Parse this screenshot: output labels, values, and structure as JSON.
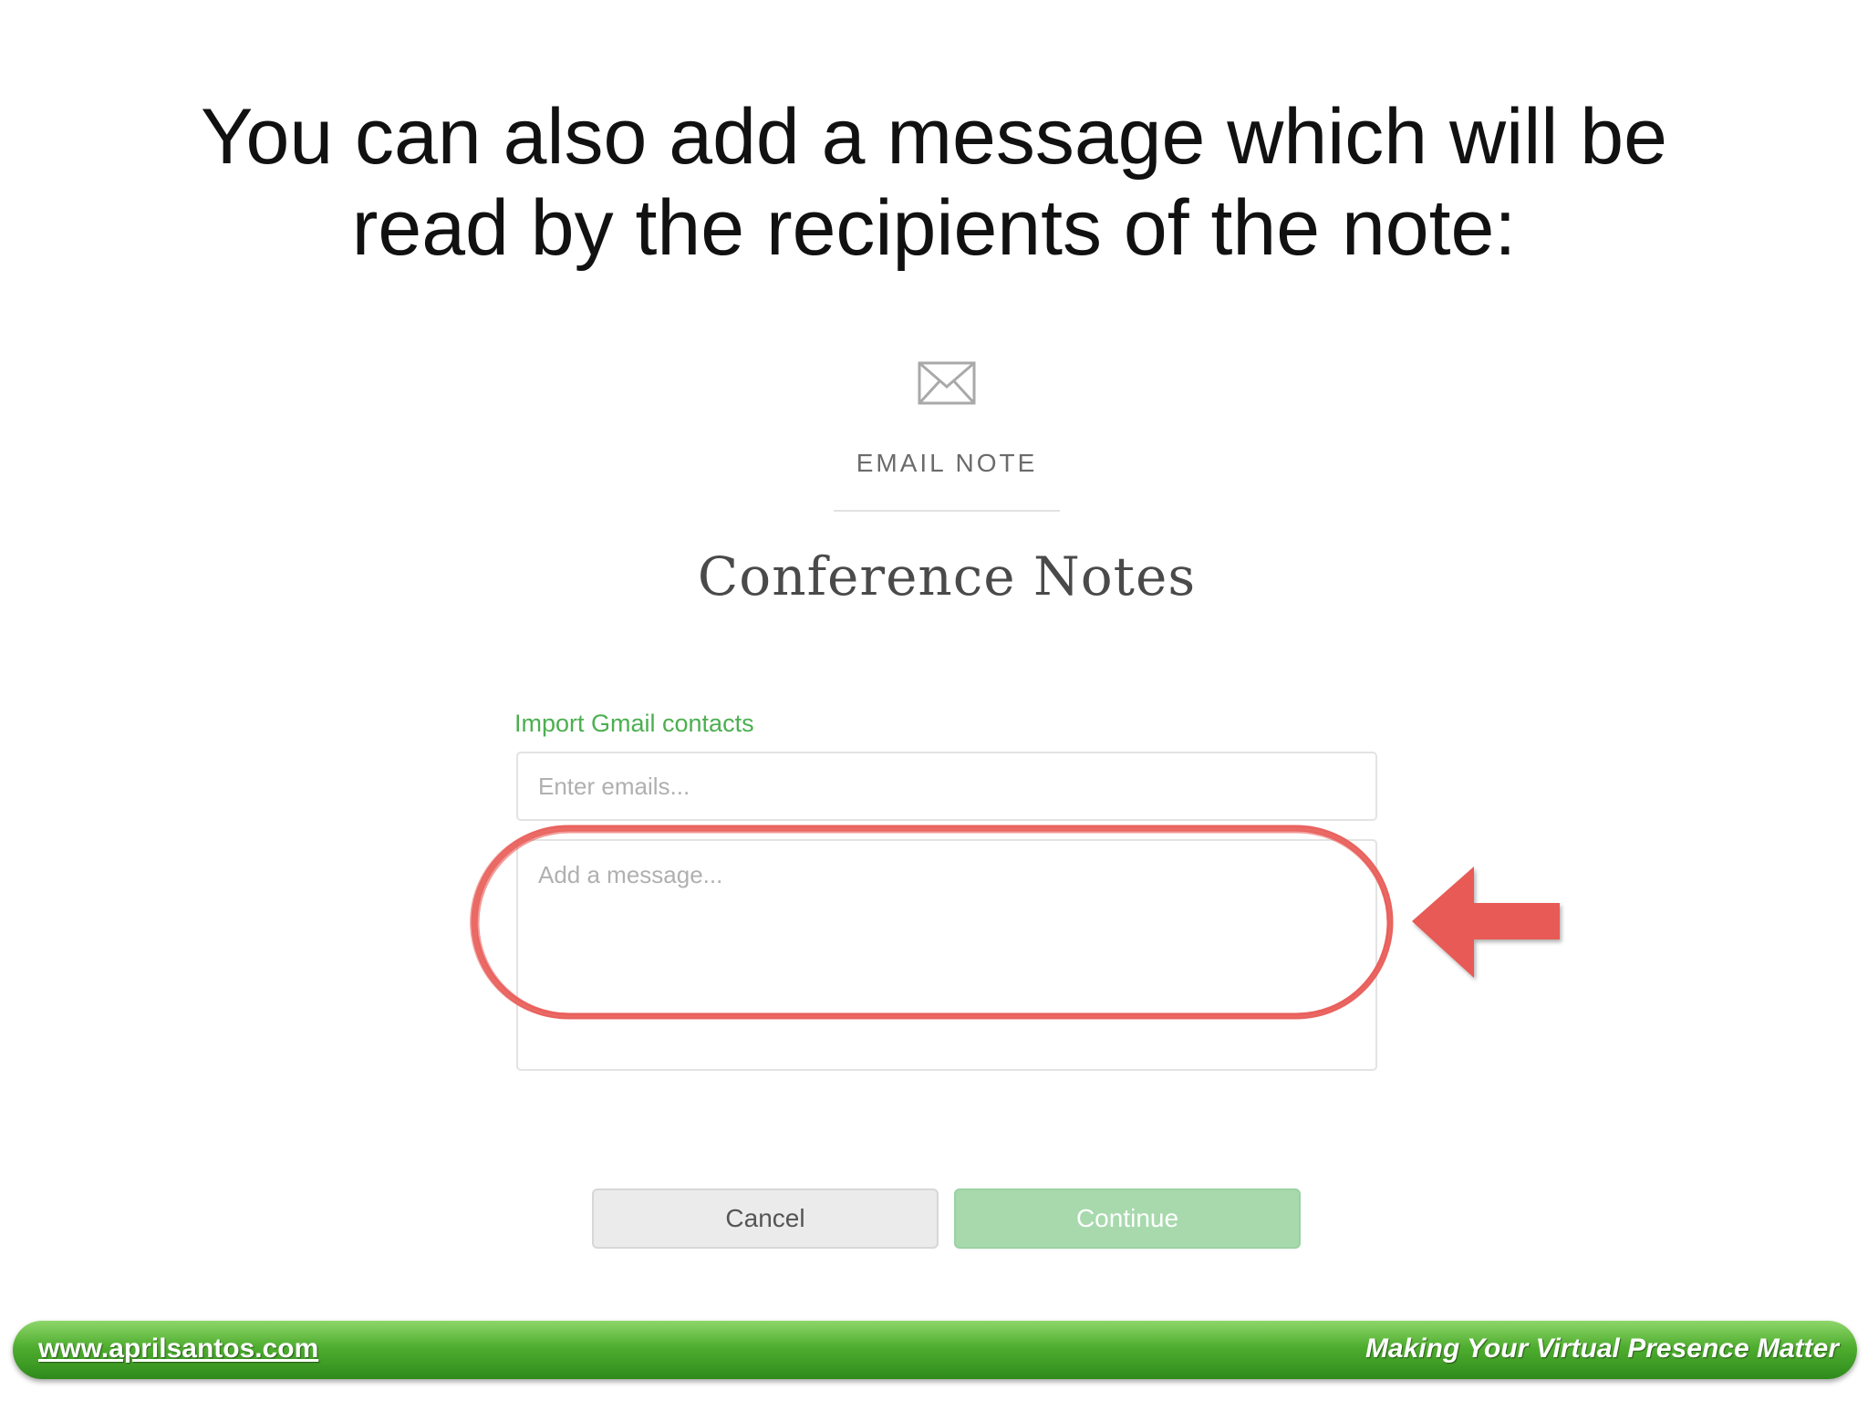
{
  "slide": {
    "heading_line1": "You can also add a message which will be",
    "heading_line2": "read by the recipients of the note:"
  },
  "dialog": {
    "icon": "envelope-icon",
    "label": "EMAIL NOTE",
    "note_title": "Conference Notes",
    "import_link": "Import Gmail contacts",
    "email_placeholder": "Enter emails...",
    "message_placeholder": "Add a message...",
    "cancel_label": "Cancel",
    "continue_label": "Continue"
  },
  "annotation": {
    "highlight": "red-circle-around-message-field",
    "pointer": "left-arrow-icon",
    "color": "#e85a55"
  },
  "footer": {
    "url": "www.aprilsantos.com",
    "tagline": "Making Your Virtual Presence Matter",
    "color": "#4fae2f"
  },
  "colors": {
    "link_green": "#4caf50",
    "continue_green": "#a7d9ad",
    "heading": "#111111"
  }
}
